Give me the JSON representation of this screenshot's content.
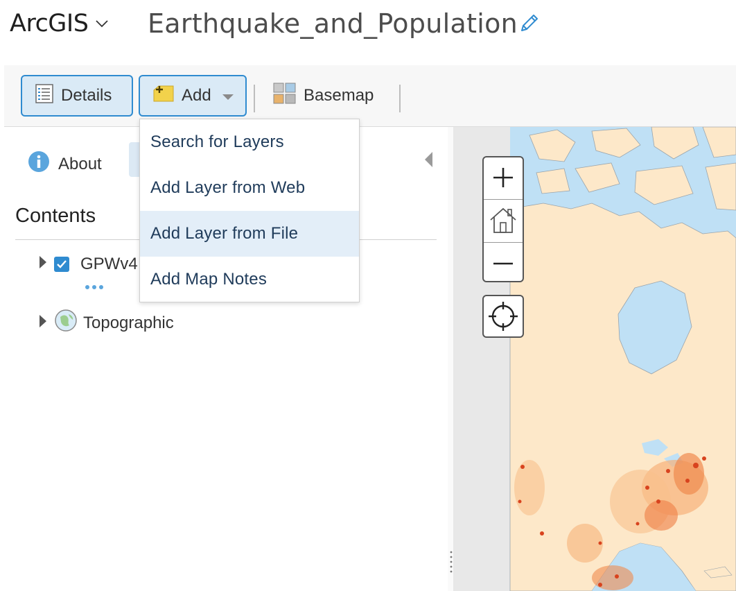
{
  "app": {
    "brand": "ArcGIS",
    "map_title": "Earthquake_and_Population"
  },
  "toolbar": {
    "details_label": "Details",
    "add_label": "Add",
    "basemap_label": "Basemap"
  },
  "side_panel": {
    "about_label": "About",
    "contents_title": "Contents",
    "layers": [
      {
        "name": "GPWv4",
        "checked": true
      },
      {
        "name": "Topographic"
      }
    ]
  },
  "add_menu": {
    "items": [
      {
        "label": "Search for Layers"
      },
      {
        "label": "Add Layer from Web"
      },
      {
        "label": "Add Layer from File",
        "highlighted": true
      },
      {
        "label": "Add Map Notes"
      }
    ]
  },
  "colors": {
    "accent": "#2f8bd0",
    "ocean": "#bfe0f5",
    "land": "#fde8c9",
    "population_dense": "#d8431e",
    "menu_highlight": "#e3eef8"
  }
}
